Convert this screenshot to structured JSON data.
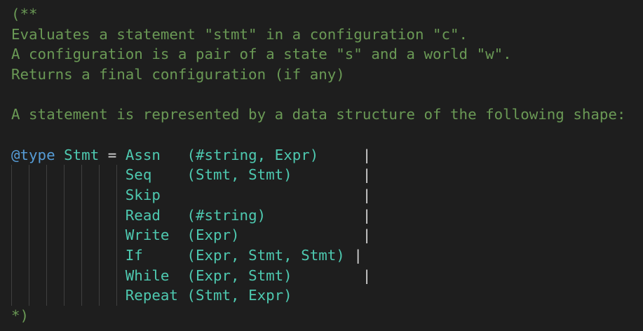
{
  "editor": {
    "comment_lines": [
      "(**",
      "Evaluates a statement \"stmt\" in a configuration \"c\".",
      "A configuration is a pair of a state \"s\" and a world \"w\".",
      "Returns a final configuration (if any)",
      "",
      "A statement is represented by a data structure of the following shape:",
      ""
    ],
    "type_decl": {
      "keyword": "@type",
      "name": "Stmt",
      "equals": "=",
      "first_variant": "Assn   (#string, Expr)     ",
      "separator": "|"
    },
    "variants": [
      {
        "text": "Seq    (Stmt, Stmt)        ",
        "sep": "|"
      },
      {
        "text": "Skip                       ",
        "sep": "|"
      },
      {
        "text": "Read   (#string)           ",
        "sep": "|"
      },
      {
        "text": "Write  (Expr)              ",
        "sep": "|"
      },
      {
        "text": "If     (Expr, Stmt, Stmt) ",
        "sep": "|"
      },
      {
        "text": "While  (Expr, Stmt)        ",
        "sep": "|"
      },
      {
        "text": "Repeat (Stmt, Expr)",
        "sep": ""
      }
    ],
    "comment_end": "*)",
    "colors": {
      "background": "#1e1e1e",
      "comment": "#6a9955",
      "keyword": "#569cd6",
      "type": "#4ec9b0",
      "operator": "#d4d4d4"
    }
  }
}
